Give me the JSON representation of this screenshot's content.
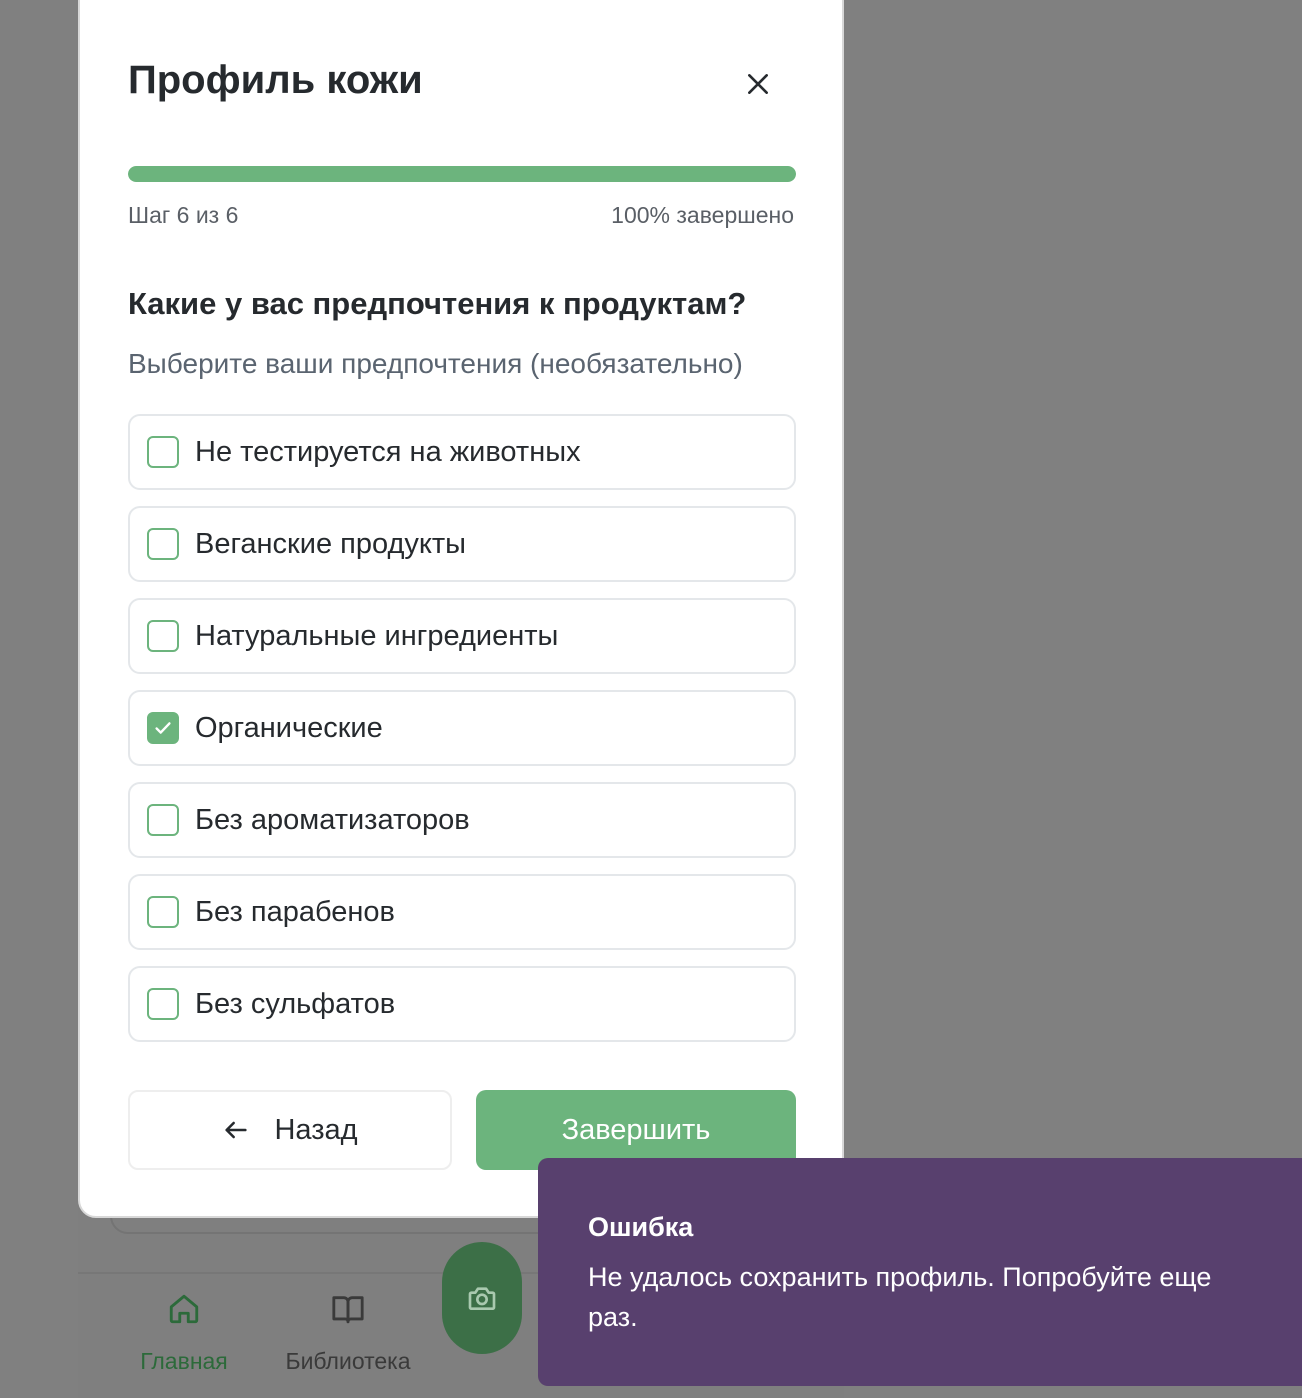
{
  "background": {
    "nav": {
      "items": [
        {
          "label": "Главная",
          "icon": "home-icon",
          "active": true
        },
        {
          "label": "Библиотека",
          "icon": "book-icon",
          "active": false
        }
      ],
      "fab_icon": "camera-icon"
    }
  },
  "modal": {
    "title": "Профиль кожи",
    "close_icon": "close-icon",
    "progress": {
      "percent": 100,
      "step_text": "Шаг 6 из 6",
      "percent_text": "100% завершено"
    },
    "question": "Какие у вас предпочтения к продуктам?",
    "hint": "Выберите ваши предпочтения (необязательно)",
    "options": [
      {
        "label": "Не тестируется на животных",
        "checked": false
      },
      {
        "label": "Веганские продукты",
        "checked": false
      },
      {
        "label": "Натуральные ингредиенты",
        "checked": false
      },
      {
        "label": "Органические",
        "checked": true
      },
      {
        "label": "Без ароматизаторов",
        "checked": false
      },
      {
        "label": "Без парабенов",
        "checked": false
      },
      {
        "label": "Без сульфатов",
        "checked": false
      }
    ],
    "back_label": "Назад",
    "finish_label": "Завершить"
  },
  "toast": {
    "title": "Ошибка",
    "message": "Не удалось сохранить профиль. Попробуйте еще раз."
  },
  "colors": {
    "accent": "#6cb47d",
    "toast_bg": "#58406e",
    "overlay": "#808080"
  }
}
